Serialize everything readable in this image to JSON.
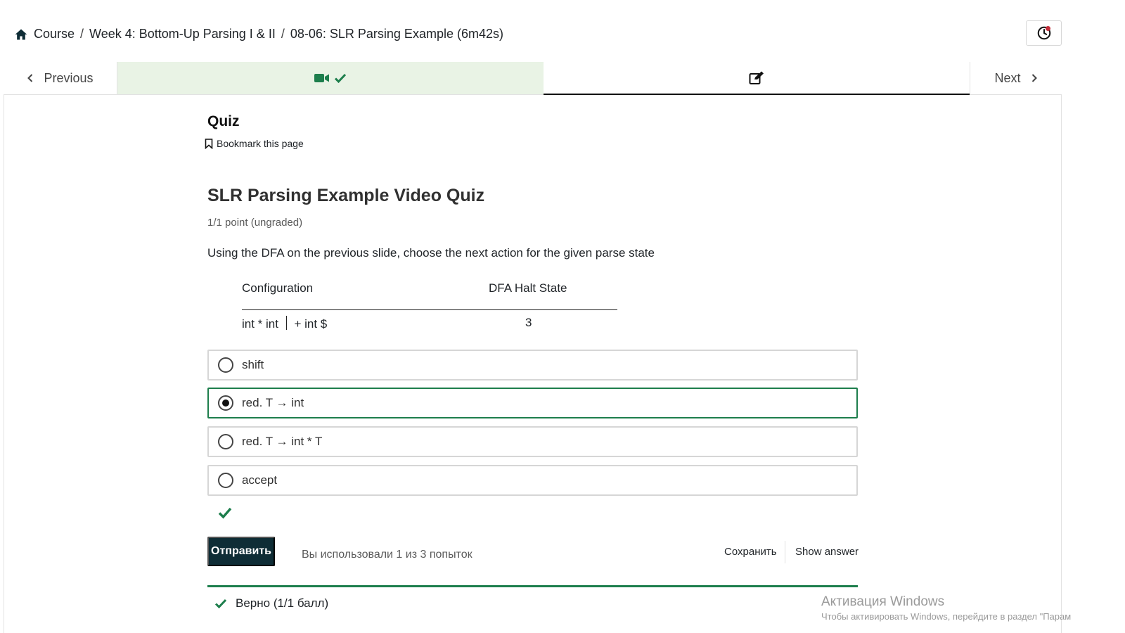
{
  "breadcrumb": {
    "home_label": "Course",
    "week_label": "Week 4: Bottom-Up Parsing I & II",
    "unit_label": "08-06: SLR Parsing Example (6m42s)",
    "separator": "/"
  },
  "unit_nav": {
    "previous_label": "Previous",
    "next_label": "Next"
  },
  "page": {
    "title": "Quiz",
    "bookmark_label": "Bookmark this page"
  },
  "problem": {
    "title": "SLR Parsing Example Video Quiz",
    "points": "1/1 point (ungraded)",
    "question": "Using the DFA on the previous slide, choose the next action for the given parse state",
    "table": {
      "header_config": "Configuration",
      "header_state": "DFA Halt State",
      "config_before": "int * int",
      "config_after": "+ int $",
      "state": "3"
    },
    "choices": [
      {
        "label": "shift",
        "selected": false
      },
      {
        "label": "red. T → int",
        "selected": true
      },
      {
        "label": "red. T → int * T",
        "selected": false
      },
      {
        "label": "accept",
        "selected": false
      }
    ],
    "submit_label": "Отправить",
    "attempts_text": "Вы использовали 1 из 3 попыток",
    "save_label": "Сохранить",
    "show_answer_label": "Show answer",
    "result_text": "Верно (1/1 балл)"
  },
  "watermark": {
    "line1": "Активация Windows",
    "line2": "Чтобы активировать Windows, перейдите в раздел \"Парам"
  },
  "colors": {
    "accent_green": "#1d7e4c",
    "video_tab_bg": "#e9f3e5",
    "submit_bg": "#0f2d36"
  },
  "icons": {
    "home": "home-icon",
    "history": "history-icon",
    "video": "video-camera-icon",
    "check": "check-icon",
    "edit": "edit-icon",
    "bookmark": "bookmark-icon"
  }
}
